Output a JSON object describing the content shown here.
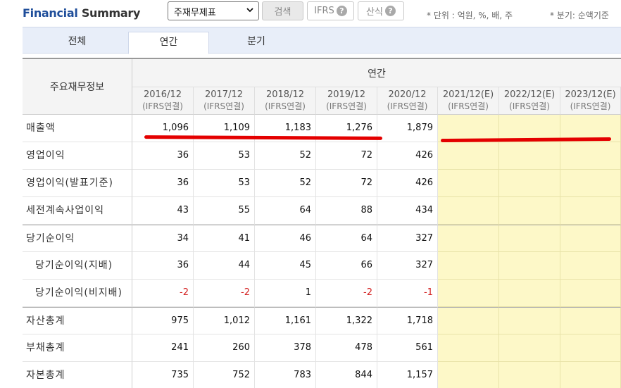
{
  "header": {
    "title_part1": "Financial",
    "title_part2": "Summary",
    "select_value": "주재무제표",
    "search_label": "검색",
    "ifrs_label": "IFRS",
    "formula_label": "산식",
    "help_glyph": "?",
    "unit_note": "* 단위 : 억원, %, 배, 주",
    "quarter_note": "* 분기: 순액기준"
  },
  "tabs": {
    "all": "전체",
    "annual": "연간",
    "quarter": "분기"
  },
  "table": {
    "row_header": "주요재무정보",
    "group_header": "연간",
    "periods": [
      {
        "year": "2016/12",
        "basis": "(IFRS연결)"
      },
      {
        "year": "2017/12",
        "basis": "(IFRS연결)"
      },
      {
        "year": "2018/12",
        "basis": "(IFRS연결)"
      },
      {
        "year": "2019/12",
        "basis": "(IFRS연결)"
      },
      {
        "year": "2020/12",
        "basis": "(IFRS연결)"
      },
      {
        "year": "2021/12(E)",
        "basis": "(IFRS연결)"
      },
      {
        "year": "2022/12(E)",
        "basis": "(IFRS연결)"
      },
      {
        "year": "2023/12(E)",
        "basis": "(IFRS연결)"
      }
    ],
    "rows": [
      {
        "label": "매출액",
        "values": [
          "1,096",
          "1,109",
          "1,183",
          "1,276",
          "1,879",
          "",
          "",
          ""
        ]
      },
      {
        "label": "영업이익",
        "values": [
          "36",
          "53",
          "52",
          "72",
          "426",
          "",
          "",
          ""
        ]
      },
      {
        "label": "영업이익(발표기준)",
        "values": [
          "36",
          "53",
          "52",
          "72",
          "426",
          "",
          "",
          ""
        ]
      },
      {
        "label": "세전계속사업이익",
        "values": [
          "43",
          "55",
          "64",
          "88",
          "434",
          "",
          "",
          ""
        ]
      },
      {
        "label": "당기순이익",
        "values": [
          "34",
          "41",
          "46",
          "64",
          "327",
          "",
          "",
          ""
        ]
      },
      {
        "label": "당기순이익(지배)",
        "values": [
          "36",
          "44",
          "45",
          "66",
          "327",
          "",
          "",
          ""
        ]
      },
      {
        "label": "당기순이익(비지배)",
        "values": [
          "-2",
          "-2",
          "1",
          "-2",
          "-1",
          "",
          "",
          ""
        ]
      },
      {
        "label": "자산총계",
        "values": [
          "975",
          "1,012",
          "1,161",
          "1,322",
          "1,718",
          "",
          "",
          ""
        ]
      },
      {
        "label": "부채총계",
        "values": [
          "241",
          "260",
          "378",
          "478",
          "561",
          "",
          "",
          ""
        ]
      },
      {
        "label": "자본총계",
        "values": [
          "735",
          "752",
          "783",
          "844",
          "1,157",
          "",
          "",
          ""
        ]
      }
    ]
  },
  "colors": {
    "brand": "#1f4e9a",
    "negative": "#d32020",
    "estimate_bg": "#fdf8c8",
    "annotation": "#e40000"
  }
}
